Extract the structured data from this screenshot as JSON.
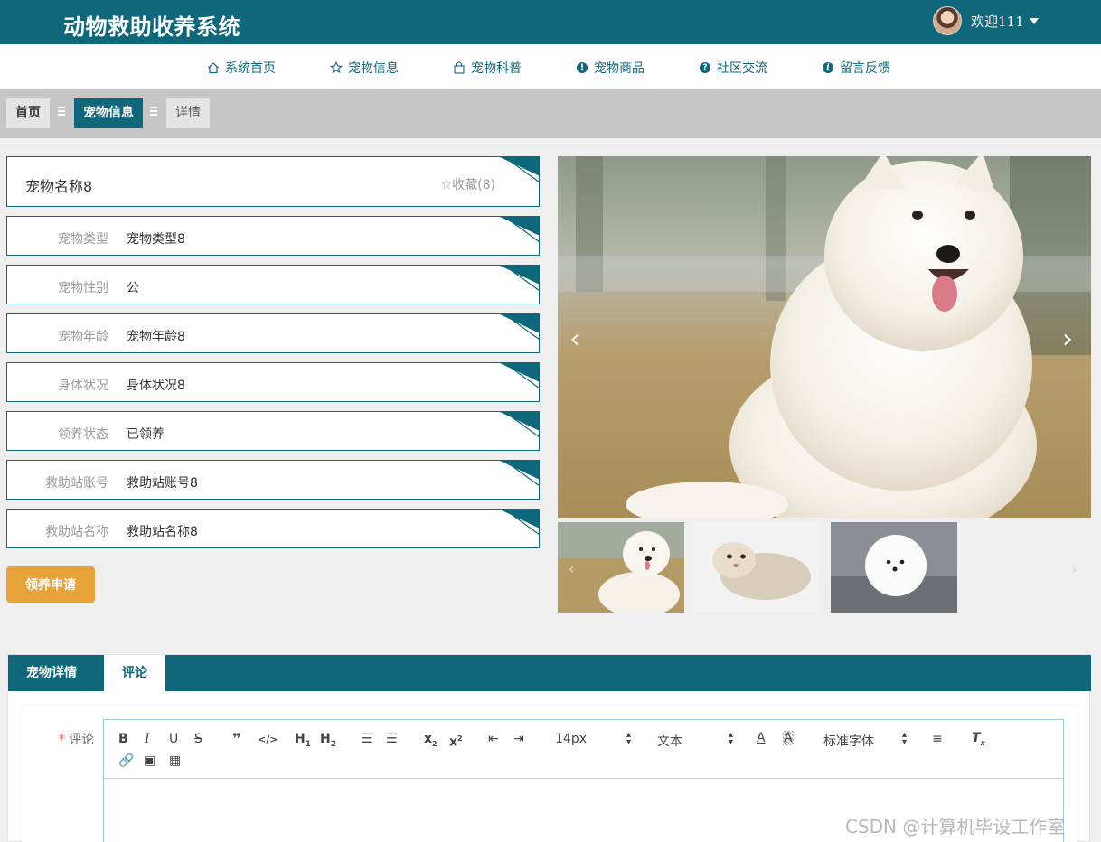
{
  "header": {
    "title": "动物救助收养系统",
    "welcome": "欢迎111"
  },
  "nav": {
    "items": [
      {
        "label": "系统首页",
        "icon": "home-icon"
      },
      {
        "label": "宠物信息",
        "icon": "star-icon"
      },
      {
        "label": "宠物科普",
        "icon": "bag-icon"
      },
      {
        "label": "宠物商品",
        "icon": "exclamation-icon"
      },
      {
        "label": "社区交流",
        "icon": "question-icon"
      },
      {
        "label": "留言反馈",
        "icon": "info-icon"
      }
    ]
  },
  "breadcrumb": {
    "home": "首页",
    "current": "宠物信息",
    "detail": "详情"
  },
  "pet": {
    "name": "宠物名称8",
    "favorite": "收藏(8)",
    "fields": [
      {
        "label": "宠物类型",
        "value": "宠物类型8"
      },
      {
        "label": "宠物性别",
        "value": "公"
      },
      {
        "label": "宠物年龄",
        "value": "宠物年龄8"
      },
      {
        "label": "身体状况",
        "value": "身体状况8"
      },
      {
        "label": "领养状态",
        "value": "已领养"
      },
      {
        "label": "救助站账号",
        "value": "救助站账号8"
      },
      {
        "label": "救助站名称",
        "value": "救助站名称8"
      }
    ],
    "apply_button": "领养申请"
  },
  "tabs": {
    "detail": "宠物详情",
    "comment": "评论"
  },
  "comment_form": {
    "required_mark": "*",
    "label": "评论",
    "font_size": "14px",
    "text_style": "文本",
    "font_family": "标准字体"
  },
  "watermark": "CSDN @计算机毕设工作室",
  "colors": {
    "primary": "#0f677b",
    "accent": "#e8a23a",
    "breadcrumb_bg": "#c6c6c6"
  }
}
